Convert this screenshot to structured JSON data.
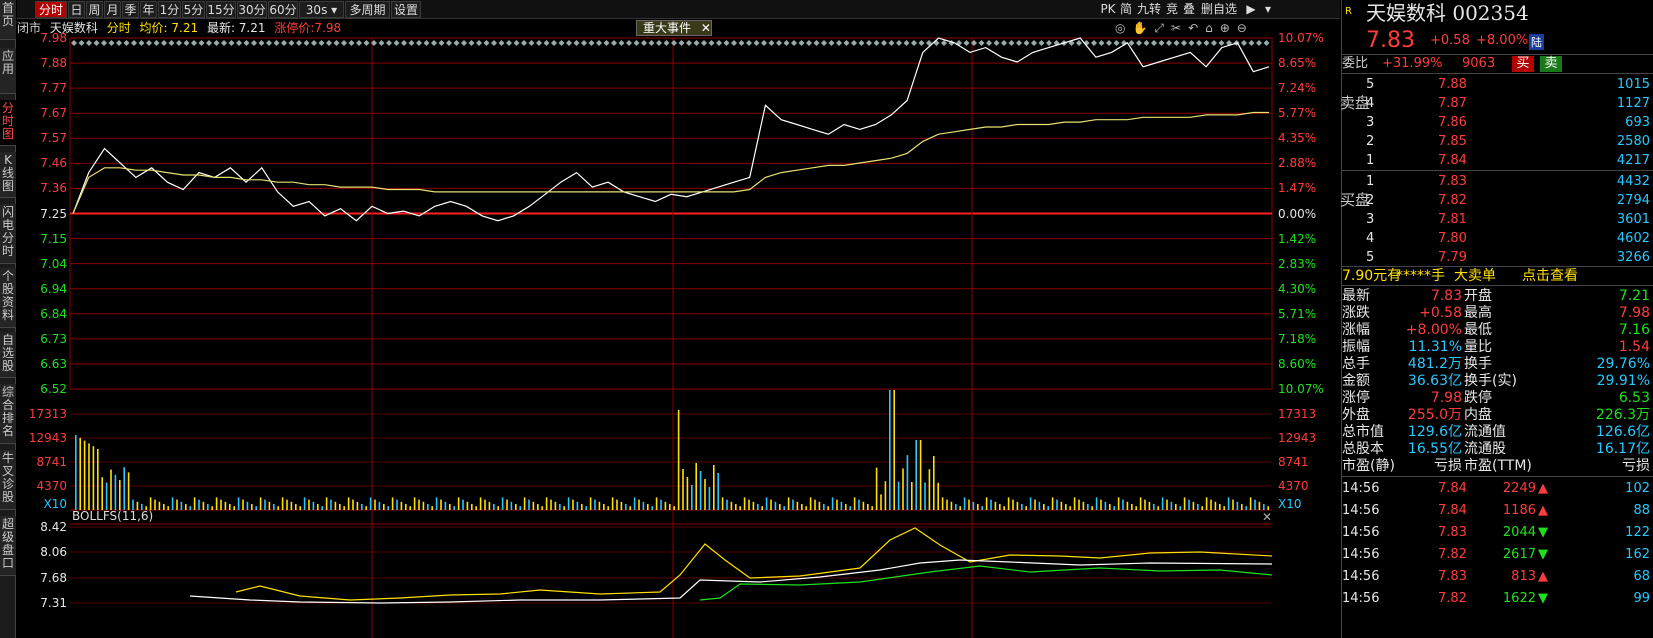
{
  "sidebar": {
    "tabs": [
      {
        "label": "首页"
      },
      {
        "label": "应用"
      },
      {
        "label": "分时图"
      },
      {
        "label": "K线图"
      },
      {
        "label": "闪电分时"
      },
      {
        "label": "个股资料"
      },
      {
        "label": "自选股"
      },
      {
        "label": "综合排名"
      },
      {
        "label": "牛叉诊股"
      },
      {
        "label": "超级盘口"
      }
    ]
  },
  "toolbar": {
    "periods": [
      "分时",
      "日",
      "周",
      "月",
      "季",
      "年",
      "1分",
      "5分",
      "15分",
      "30分",
      "60分",
      "30s",
      "多周期",
      "设置"
    ],
    "active": "分时",
    "right": [
      "PK",
      "简",
      "九转",
      "竞",
      "叠",
      "删自选"
    ]
  },
  "info": {
    "status": "闭市",
    "name": "天娱数科",
    "view": "分时",
    "avg": "均价: 7.21",
    "latest": "最新: 7.21",
    "limit": "涨停价:7.98",
    "event": "重大事件"
  },
  "price_axis": {
    "left": [
      "7.98",
      "7.88",
      "7.77",
      "7.67",
      "7.57",
      "7.46",
      "7.36",
      "7.25",
      "7.15",
      "7.04",
      "6.94",
      "6.84",
      "6.73",
      "6.63",
      "6.52"
    ],
    "right": [
      "10.07%",
      "8.65%",
      "7.24%",
      "5.77%",
      "4.35%",
      "2.88%",
      "1.47%",
      "0.00%",
      "1.42%",
      "2.83%",
      "4.30%",
      "5.71%",
      "7.18%",
      "8.60%",
      "10.07%"
    ]
  },
  "vol_axis": {
    "labels": [
      "17313",
      "12943",
      "8741",
      "4370"
    ],
    "unit": "X10"
  },
  "indicator": {
    "name": "BOLLFS(11,6)",
    "labels": [
      "8.42",
      "8.06",
      "7.68",
      "7.31"
    ]
  },
  "quote": {
    "logo": "R",
    "title": "天娱数科 002354",
    "price": "7.83",
    "change": "+0.58",
    "pct": "+8.00%",
    "tag": "陆",
    "wb_label": "委比",
    "wb_pct": "+31.99%",
    "wb_diff": "9063",
    "sell_btn": "买",
    "buy_btn": "卖",
    "sell_side": "卖盘",
    "buy_side": "买盘",
    "asks": [
      {
        "lvl": "5",
        "price": "7.88",
        "vol": "1015"
      },
      {
        "lvl": "4",
        "price": "7.87",
        "vol": "1127"
      },
      {
        "lvl": "3",
        "price": "7.86",
        "vol": "693"
      },
      {
        "lvl": "2",
        "price": "7.85",
        "vol": "2580"
      },
      {
        "lvl": "1",
        "price": "7.84",
        "vol": "4217"
      }
    ],
    "bids": [
      {
        "lvl": "1",
        "price": "7.83",
        "vol": "4432"
      },
      {
        "lvl": "2",
        "price": "7.82",
        "vol": "2794"
      },
      {
        "lvl": "3",
        "price": "7.81",
        "vol": "3601"
      },
      {
        "lvl": "4",
        "price": "7.80",
        "vol": "4602"
      },
      {
        "lvl": "5",
        "price": "7.79",
        "vol": "3266"
      }
    ],
    "bigorder": {
      "a": "7.90元有",
      "b": "*****手",
      "c": "大卖单",
      "d": "点击查看"
    },
    "stats": [
      [
        "最新",
        "7.83",
        "开盘",
        "7.21"
      ],
      [
        "涨跌",
        "+0.58",
        "最高",
        "7.98"
      ],
      [
        "涨幅",
        "+8.00%",
        "最低",
        "7.16"
      ],
      [
        "振幅",
        "11.31%",
        "量比",
        "1.54"
      ],
      [
        "总手",
        "481.2万",
        "换手",
        "29.76%"
      ],
      [
        "金额",
        "36.63亿",
        "换手(实)",
        "29.91%"
      ],
      [
        "涨停",
        "7.98",
        "跌停",
        "6.53"
      ],
      [
        "外盘",
        "255.0万",
        "内盘",
        "226.3万"
      ],
      [
        "总市值",
        "129.6亿",
        "流通值",
        "126.6亿"
      ],
      [
        "总股本",
        "16.55亿",
        "流通股",
        "16.17亿"
      ],
      [
        "市盈(静)",
        "亏损",
        "市盈(TTM)",
        "亏损"
      ]
    ],
    "ticks": [
      {
        "time": "14:56",
        "price": "7.84",
        "vol": "2249",
        "dir": "up",
        "n": "102"
      },
      {
        "time": "14:56",
        "price": "7.84",
        "vol": "1186",
        "dir": "up",
        "n": "88"
      },
      {
        "time": "14:56",
        "price": "7.83",
        "vol": "2044",
        "dir": "down",
        "n": "122"
      },
      {
        "time": "14:56",
        "price": "7.82",
        "vol": "2617",
        "dir": "down",
        "n": "162"
      },
      {
        "time": "14:56",
        "price": "7.83",
        "vol": "813",
        "dir": "up",
        "n": "68"
      },
      {
        "time": "14:56",
        "price": "7.82",
        "vol": "1622",
        "dir": "down",
        "n": "99"
      }
    ]
  },
  "chart_data": {
    "type": "line",
    "prev_close": 7.25,
    "ylim": [
      6.52,
      7.98
    ],
    "series": [
      {
        "name": "最新",
        "values": [
          7.25,
          7.42,
          7.52,
          7.46,
          7.4,
          7.44,
          7.38,
          7.35,
          7.42,
          7.4,
          7.44,
          7.38,
          7.44,
          7.34,
          7.28,
          7.3,
          7.24,
          7.27,
          7.22,
          7.28,
          7.25,
          7.26,
          7.24,
          7.28,
          7.3,
          7.28,
          7.24,
          7.22,
          7.24,
          7.28,
          7.33,
          7.38,
          7.42,
          7.36,
          7.38,
          7.34,
          7.32,
          7.3,
          7.33,
          7.32,
          7.34,
          7.36,
          7.38,
          7.4,
          7.7,
          7.64,
          7.62,
          7.6,
          7.58,
          7.62,
          7.6,
          7.62,
          7.66,
          7.72,
          7.92,
          7.98,
          7.96,
          7.92,
          7.94,
          7.9,
          7.88,
          7.92,
          7.94,
          7.96,
          7.98,
          7.9,
          7.92,
          7.96,
          7.86,
          7.88,
          7.9,
          7.92,
          7.86,
          7.94,
          7.96,
          7.84,
          7.86
        ]
      },
      {
        "name": "均价",
        "values": [
          7.25,
          7.4,
          7.44,
          7.44,
          7.43,
          7.43,
          7.42,
          7.41,
          7.41,
          7.4,
          7.4,
          7.39,
          7.39,
          7.38,
          7.38,
          7.37,
          7.37,
          7.36,
          7.36,
          7.36,
          7.35,
          7.35,
          7.35,
          7.34,
          7.34,
          7.34,
          7.34,
          7.34,
          7.34,
          7.34,
          7.34,
          7.34,
          7.34,
          7.34,
          7.34,
          7.34,
          7.34,
          7.34,
          7.34,
          7.34,
          7.34,
          7.34,
          7.34,
          7.35,
          7.4,
          7.42,
          7.43,
          7.44,
          7.45,
          7.45,
          7.46,
          7.47,
          7.48,
          7.5,
          7.55,
          7.58,
          7.59,
          7.6,
          7.61,
          7.61,
          7.62,
          7.62,
          7.62,
          7.63,
          7.63,
          7.64,
          7.64,
          7.64,
          7.65,
          7.65,
          7.65,
          7.65,
          7.66,
          7.66,
          7.66,
          7.67,
          7.67
        ]
      }
    ]
  }
}
